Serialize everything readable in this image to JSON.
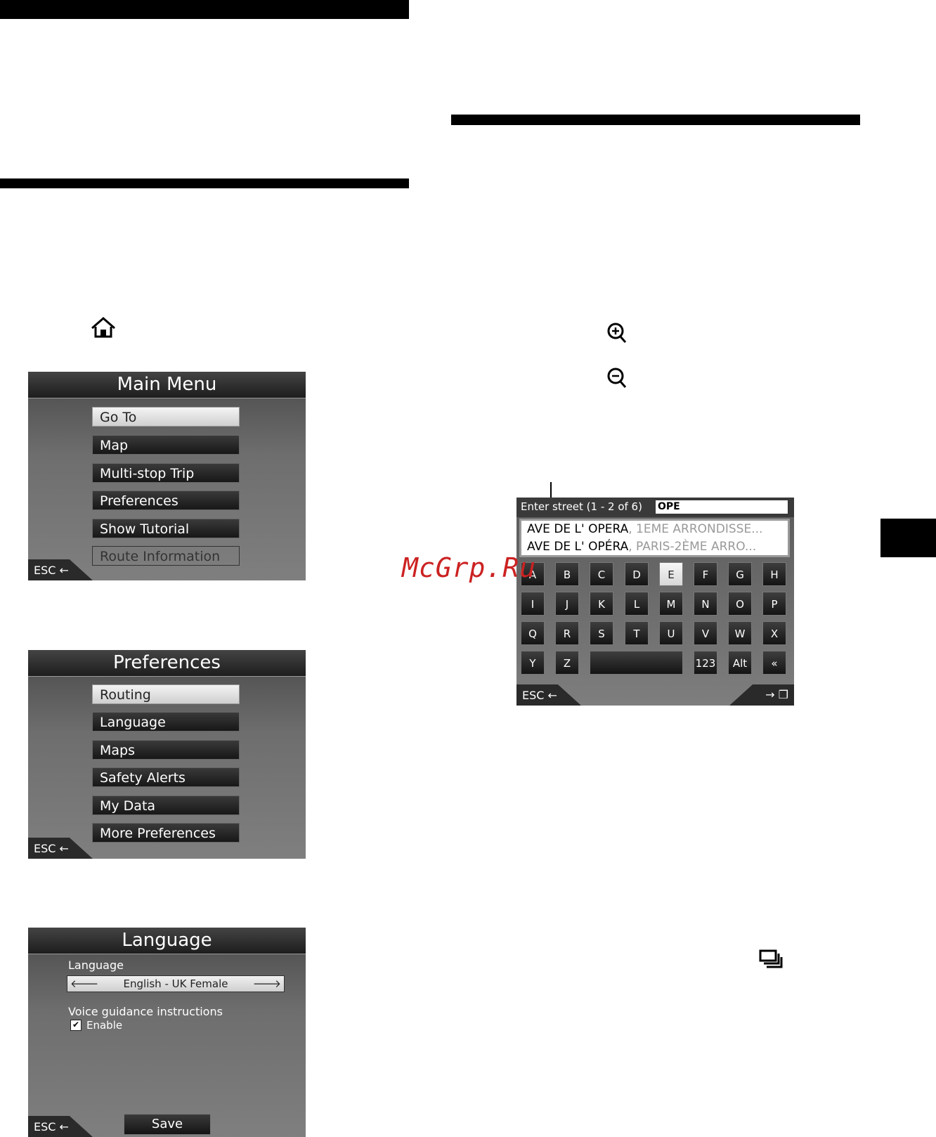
{
  "main_menu": {
    "title": "Main Menu",
    "items": [
      "Go To",
      "Map",
      "Multi-stop Trip",
      "Preferences",
      "Show Tutorial",
      "Route Information"
    ],
    "esc": "ESC"
  },
  "preferences": {
    "title": "Preferences",
    "items": [
      "Routing",
      "Language",
      "Maps",
      "Safety Alerts",
      "My Data",
      "More Preferences"
    ],
    "esc": "ESC"
  },
  "language": {
    "title": "Language",
    "field_label": "Language",
    "value": "English - UK Female",
    "voice_label": "Voice guidance instructions",
    "enable_label": "Enable",
    "enabled": true,
    "save": "Save",
    "esc": "ESC"
  },
  "keyboard": {
    "prompt": "Enter street (1 - 2 of 6)",
    "input_value": "OPE",
    "results": [
      {
        "main": "AVE DE L' OPERA",
        "sub": ", 1EME ARRONDISSE..."
      },
      {
        "main": "AVE DE L' OPÉRA",
        "sub": ", PARIS-2ÈME ARRO..."
      }
    ],
    "keys": [
      [
        "A",
        "B",
        "C",
        "D",
        "E",
        "F",
        "G",
        "H"
      ],
      [
        "I",
        "J",
        "K",
        "L",
        "M",
        "N",
        "O",
        "P"
      ],
      [
        "Q",
        "R",
        "S",
        "T",
        "U",
        "V",
        "W",
        "X"
      ],
      [
        "Y",
        "Z",
        "",
        "123",
        "Alt",
        "«"
      ]
    ],
    "selected_key": "E",
    "esc": "ESC"
  },
  "watermark": "McGrp.Ru",
  "icons": [
    "home-icon",
    "zoom-in-icon",
    "zoom-out-icon",
    "list-view-icon"
  ]
}
